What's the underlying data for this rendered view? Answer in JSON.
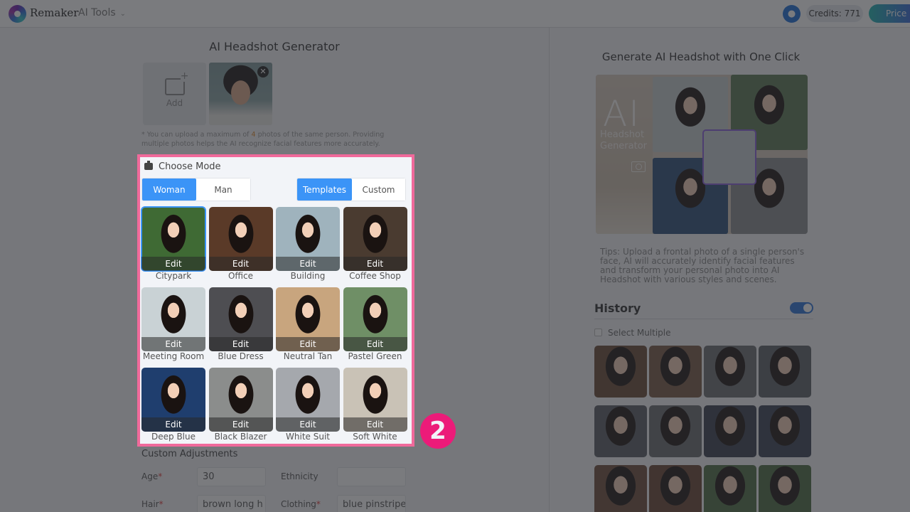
{
  "topbar": {
    "brand": "Remaker",
    "menu_label": "AI Tools",
    "credits_label": "Credits: 771",
    "price_label": "Price"
  },
  "left": {
    "title": "AI Headshot Generator",
    "add_label": "Add",
    "note_prefix": "* You can upload a maximum of ",
    "note_max": "4",
    "note_suffix": " photos of the same person. Providing multiple photos helps the AI recognize facial features more accurately.",
    "choose_mode": {
      "title": "Choose Mode",
      "gender_options": [
        "Woman",
        "Man"
      ],
      "gender_selected": "Woman",
      "mode_options": [
        "Templates",
        "Custom"
      ],
      "mode_selected": "Templates",
      "edit_label": "Edit",
      "templates": [
        {
          "name": "Citypark",
          "selected": true,
          "bg": "#3f6a34"
        },
        {
          "name": "Office",
          "selected": false,
          "bg": "#5a3a28"
        },
        {
          "name": "Building",
          "selected": false,
          "bg": "#9fb3bd"
        },
        {
          "name": "Coffee Shop",
          "selected": false,
          "bg": "#4a3b30"
        },
        {
          "name": "Meeting Room",
          "selected": false,
          "bg": "#c9d2d5"
        },
        {
          "name": "Blue Dress",
          "selected": false,
          "bg": "#4e4e52"
        },
        {
          "name": "Neutral Tan",
          "selected": false,
          "bg": "#c8a57e"
        },
        {
          "name": "Pastel Green",
          "selected": false,
          "bg": "#6f8f66"
        },
        {
          "name": "Deep Blue",
          "selected": false,
          "bg": "#1f3e6e"
        },
        {
          "name": "Black Blazer",
          "selected": false,
          "bg": "#8b8d8c"
        },
        {
          "name": "White Suit",
          "selected": false,
          "bg": "#a5a8ad"
        },
        {
          "name": "Soft White",
          "selected": false,
          "bg": "#c9c2b6"
        }
      ]
    },
    "custom_adjustments": {
      "title": "Custom Adjustments",
      "age_label": "Age",
      "age_value": "30",
      "ethnicity_label": "Ethnicity",
      "ethnicity_value": "",
      "hair_label": "Hair",
      "hair_value": "brown long h",
      "clothing_label": "Clothing",
      "clothing_value": "blue pinstripe",
      "required_mark": "*"
    }
  },
  "right": {
    "title": "Generate AI Headshot with One Click",
    "hero_big": "AI",
    "hero_sub_1": "Headshot",
    "hero_sub_2": "Generator",
    "tips": "Tips: Upload a frontal photo of a single person's face, AI will accurately identify facial features and transform your personal photo into AI Headshot with various styles and scenes.",
    "history_title": "History",
    "history_toggle_on": true,
    "select_multiple_label": "Select Multiple",
    "history_thumbs": [
      "#6b4a35",
      "#7a5a44",
      "#6c6e72",
      "#5d6166",
      "#5a5e64",
      "#6a6c70",
      "#3a4150",
      "#3a4354",
      "#6e4e3a",
      "#6a4634",
      "#4f6e45",
      "#4c6d43"
    ]
  },
  "annotation": {
    "step_number": "2",
    "highlight_color": "#f06a9b",
    "badge_color": "#ec1b79"
  }
}
